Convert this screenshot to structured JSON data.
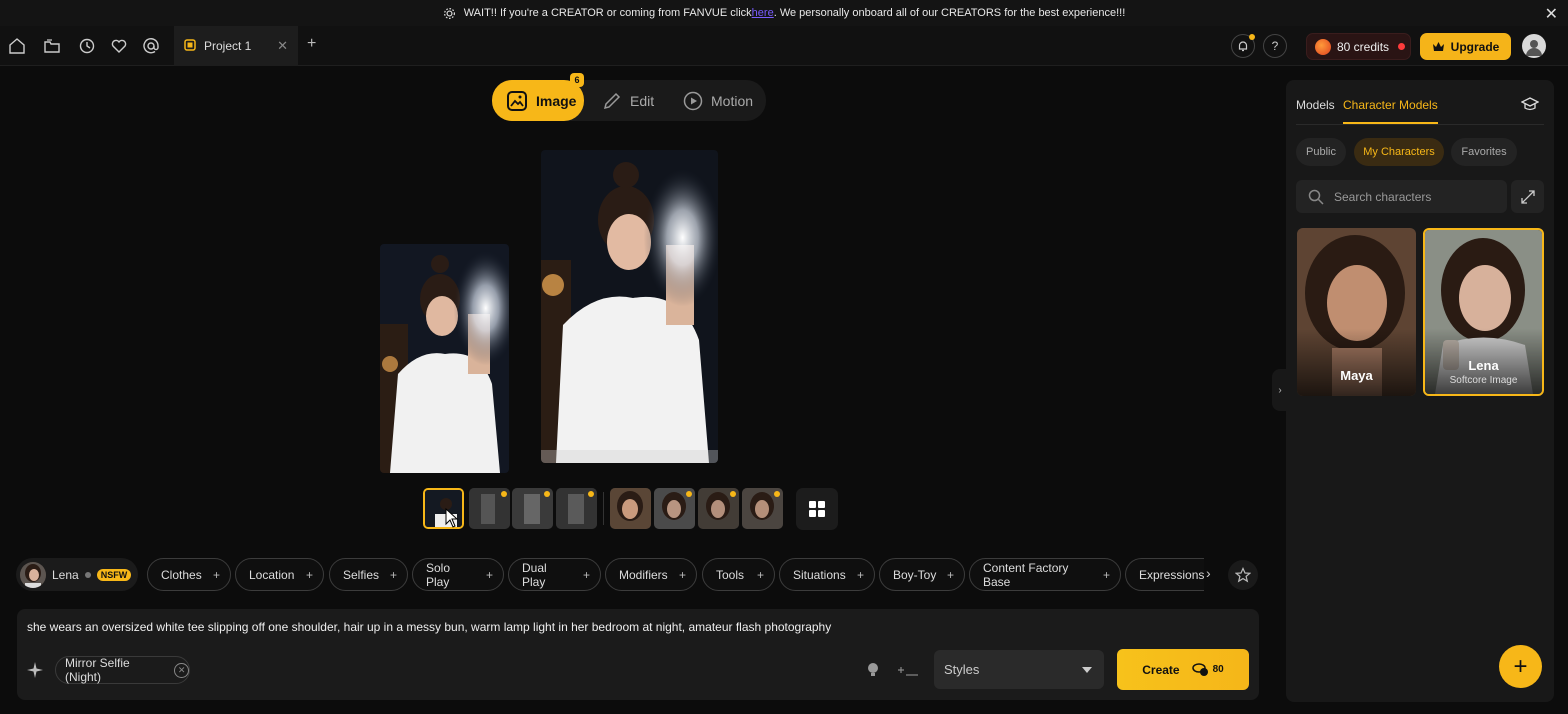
{
  "banner": {
    "text_before": "WAIT!! If you're a CREATOR or coming from FANVUE click ",
    "link": "here",
    "text_after": ". We personally onboard all of our CREATORS for the best experience!!!"
  },
  "topbar": {
    "tab_label": "Project 1",
    "new_tab": "+",
    "help": "?",
    "credits": "80 credits",
    "upgrade": "Upgrade"
  },
  "modes": {
    "image": "Image",
    "image_count": "6",
    "edit": "Edit",
    "motion": "Motion"
  },
  "character_chip": {
    "name": "Lena",
    "badge": "NSFW"
  },
  "categories": [
    "Clothes",
    "Location",
    "Selfies",
    "Solo Play",
    "Dual Play",
    "Modifiers",
    "Tools",
    "Situations",
    "Boy-Toy",
    "Content Factory Base",
    "Expressions"
  ],
  "prompt": {
    "text": "she wears an oversized white tee slipping off one shoulder, hair up in a messy bun, warm lamp light in her bedroom at night, amateur flash photography",
    "style_chip": "Mirror Selfie (Night)",
    "styles_placeholder": "Styles",
    "create_label": "Create",
    "create_cost": "80"
  },
  "panel": {
    "tabs": [
      "Models",
      "Character Models"
    ],
    "filters": [
      "Public",
      "My Characters",
      "Favorites"
    ],
    "search_placeholder": "Search characters",
    "cards": [
      {
        "name": "Maya",
        "subtitle": ""
      },
      {
        "name": "Lena",
        "subtitle": "Softcore Image"
      }
    ]
  },
  "colors": {
    "accent": "#f7b718",
    "background": "#0c0c0c",
    "panel": "#181818"
  }
}
